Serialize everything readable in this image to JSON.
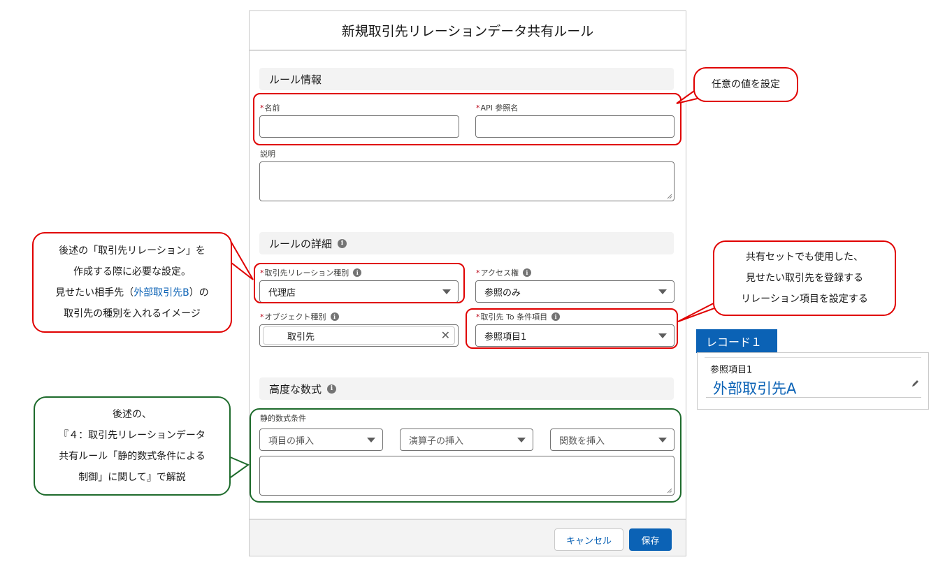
{
  "modal": {
    "title": "新規取引先リレーションデータ共有ルール",
    "sections": {
      "rule_info": "ルール情報",
      "rule_details": "ルールの詳細",
      "advanced_formula": "高度な数式"
    },
    "fields": {
      "name": {
        "label": "名前",
        "required_mark": "*",
        "value": ""
      },
      "api_name": {
        "label": "API 参照名",
        "required_mark": "*",
        "value": ""
      },
      "description": {
        "label": "説明",
        "value": ""
      },
      "relation_type": {
        "label": "取引先リレーション種別",
        "required_mark": "*",
        "value": "代理店"
      },
      "access": {
        "label": "アクセス権",
        "required_mark": "*",
        "value": "参照のみ"
      },
      "object_type": {
        "label": "オブジェクト種別",
        "required_mark": "*",
        "value": "取引先"
      },
      "account_to_field": {
        "label": "取引先 To 条件項目",
        "required_mark": "*",
        "value": "参照項目1"
      },
      "static_formula": {
        "label": "静的数式条件",
        "value": ""
      }
    },
    "formula_selects": {
      "insert_field": "項目の挿入",
      "insert_operator": "演算子の挿入",
      "insert_function": "関数を挿入"
    },
    "footer": {
      "cancel_label": "キャンセル",
      "save_label": "保存"
    }
  },
  "callouts": {
    "name_api": "任意の値を設定",
    "relation_type": {
      "line1": "後述の「取引先リレーション」を",
      "line2": "作成する際に必要な設定。",
      "line3_prefix": "見せたい相手先（",
      "line3_highlight": "外部取引先B",
      "line3_suffix": "）の",
      "line4": "取引先の種別を入れるイメージ"
    },
    "account_to_field": {
      "line1": "共有セットでも使用した、",
      "line2": "見せたい取引先を登録する",
      "line3": "リレーション項目を設定する"
    },
    "formula": {
      "line1": "後述の、",
      "line2": "『４：取引先リレーションデータ",
      "line3": "共有ルール「静的数式条件による",
      "line4": "制御」に関して』で解説"
    }
  },
  "record": {
    "tab_label": "レコード１",
    "field_label": "参照項目1",
    "field_value": "外部取引先A"
  },
  "colors": {
    "accent_blue": "#0b62b5",
    "highlight_red": "#e00000",
    "highlight_green": "#1e6b2c"
  },
  "icons": [
    "info-icon",
    "chevron-down-icon",
    "clear-icon",
    "pencil-icon",
    "resize-grip-icon"
  ]
}
